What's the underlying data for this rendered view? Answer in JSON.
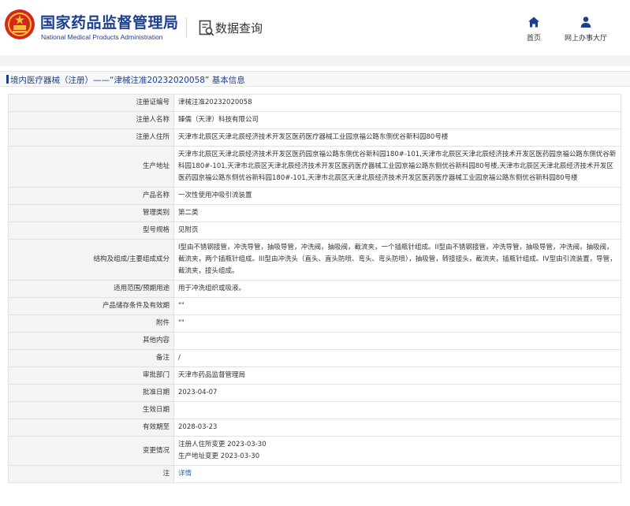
{
  "header": {
    "site_title_cn": "国家药品监督管理局",
    "site_title_en": "National Medical Products Administration",
    "section_title": "数据查询",
    "nav": [
      {
        "label": "首页",
        "icon": "home-icon"
      },
      {
        "label": "网上办事大厅",
        "icon": "user-icon"
      }
    ]
  },
  "breadcrumb": "境内医疗器械（注册）——“津械注准20232020058” 基本信息",
  "colors": {
    "brand": "#1c3f8f",
    "link": "#1c66c9",
    "label_bg": "#f4f4f4"
  },
  "rows": [
    {
      "label": "注册证编号",
      "value": "津械注准20232020058"
    },
    {
      "label": "注册人名称",
      "value": "臻儒（天津）科技有限公司"
    },
    {
      "label": "注册人住所",
      "value": "天津市北辰区天津北辰经济技术开发区医药医疗器械工业园京福公路东侧优谷新科园80号楼"
    },
    {
      "label": "生产地址",
      "value": "天津市北辰区天津北辰经济技术开发区医药园京福公路东侧优谷新科园180#-101,天津市北辰区天津北辰经济技术开发区医药园京福公路东侧优谷新科园180#-101,天津市北辰区天津北辰经济技术开发区医药医疗器械工业园京福公路东侧优谷新科园80号楼,天津市北辰区天津北辰经济技术开发区医药园京福公路东侧优谷新科园180#-101,天津市北辰区天津北辰经济技术开发区医药医疗器械工业园京福公路东侧优谷新科园80号楼"
    },
    {
      "label": "产品名称",
      "value": "一次性使用冲吸引流装置"
    },
    {
      "label": "管理类别",
      "value": "第二类"
    },
    {
      "label": "型号规格",
      "value": "见附页"
    },
    {
      "label": "结构及组成/主要组成成分",
      "value": "I型由不锈钢接管，冲洗导管，抽吸导管，冲洗阀，抽吸阀，截流夹，一个插瓶针组成。II型由不锈钢接管，冲洗导管，抽吸导管，冲洗阀，抽吸阀，截流夹，两个插瓶针组成。III型由冲洗头（直头、直头防喷、弯头、弯头防喷），抽吸管，转接接头，截流夹，插瓶针组成。IV型由引流装置，导管，截流夹，接头组成。"
    },
    {
      "label": "适用范围/预期用途",
      "value": "用于冲洗组织或吸液。"
    },
    {
      "label": "产品储存条件及有效期",
      "value": "\"\""
    },
    {
      "label": "附件",
      "value": "\"\""
    },
    {
      "label": "其他内容",
      "value": ""
    },
    {
      "label": "备注",
      "value": "/"
    },
    {
      "label": "审批部门",
      "value": "天津市药品监督管理局"
    },
    {
      "label": "批准日期",
      "value": "2023-04-07"
    },
    {
      "label": "生效日期",
      "value": ""
    },
    {
      "label": "有效期至",
      "value": "2028-03-23"
    },
    {
      "label": "变更情况",
      "value": "注册人住所变更 2023-03-30\n生产地址变更 2023-03-30"
    },
    {
      "label": "注",
      "value": "详情"
    }
  ]
}
